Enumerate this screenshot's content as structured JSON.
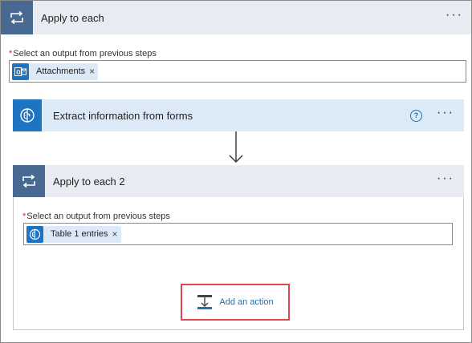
{
  "outer_loop": {
    "title": "Apply to each",
    "more": "···",
    "field_label": "Select an output from previous steps",
    "required_mark": "*",
    "token": {
      "label": "Attachments",
      "remove": "×",
      "icon": "outlook-icon"
    },
    "icon": "loop-icon"
  },
  "extract_step": {
    "title": "Extract information from forms",
    "help": "?",
    "more": "···",
    "icon": "ai-builder-icon"
  },
  "inner_loop": {
    "title": "Apply to each 2",
    "more": "···",
    "field_label": "Select an output from previous steps",
    "required_mark": "*",
    "token": {
      "label": "Table 1 entries",
      "remove": "×",
      "icon": "ai-builder-icon"
    },
    "icon": "loop-icon"
  },
  "add_action": {
    "label": "Add an action",
    "icon": "add-action-icon"
  },
  "colors": {
    "loop_icon_bg": "#486991",
    "loop_header_bg": "#e8ebf2",
    "extract_icon_bg": "#1f74c2",
    "extract_header_bg": "#dceaf7",
    "token_bg": "#dceaf7",
    "link": "#1e6fb4",
    "highlight": "#e2464b"
  }
}
